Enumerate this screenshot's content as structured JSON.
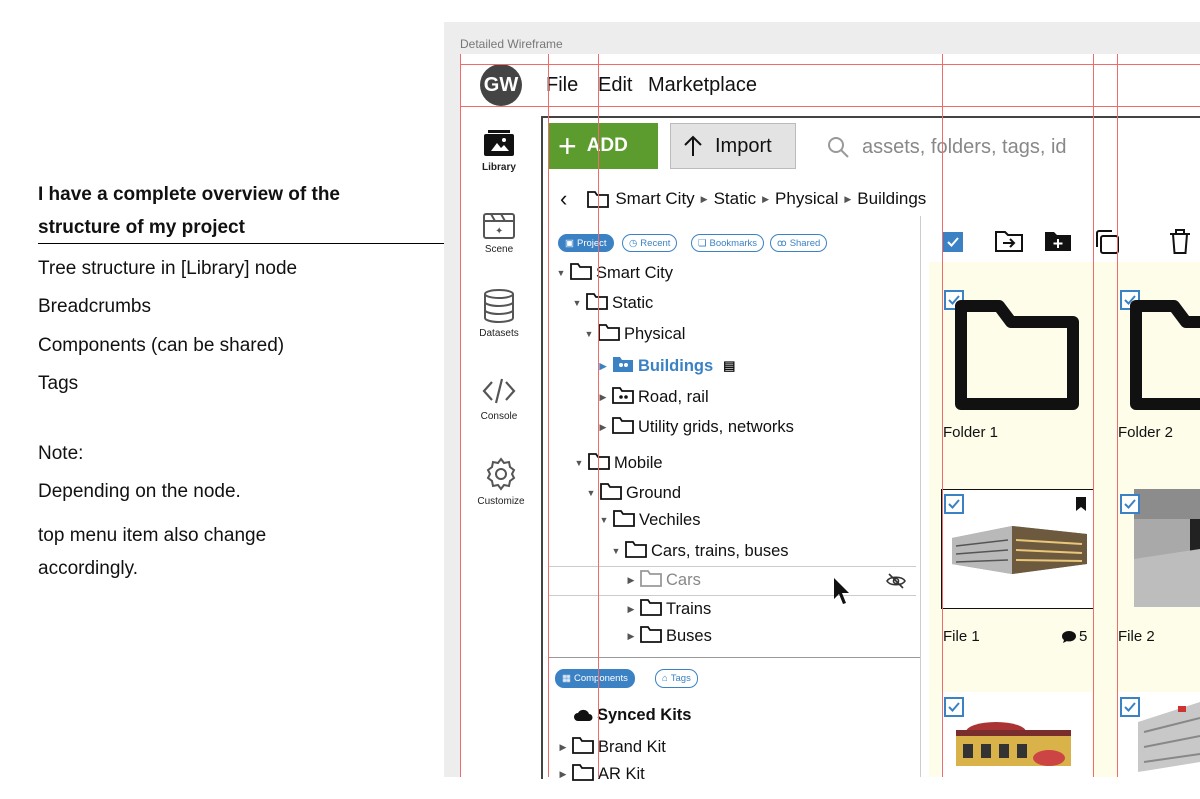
{
  "annotation": {
    "title": "I have a complete overview of the structure of my project",
    "points": [
      "Tree structure in [Library] node",
      "Breadcrumbs",
      "Components (can be shared)",
      "Tags"
    ],
    "note_label": "Note:",
    "note_lines": [
      "Depending on the node.",
      "top menu item also change accordingly."
    ]
  },
  "frame": {
    "label": "Detailed Wireframe"
  },
  "app": {
    "avatar": "GW",
    "menu": [
      "File",
      "Edit",
      "Marketplace"
    ]
  },
  "sidebar": {
    "items": [
      {
        "label": "Library",
        "icon": "library-icon"
      },
      {
        "label": "Scene",
        "icon": "scene-icon"
      },
      {
        "label": "Datasets",
        "icon": "database-icon"
      },
      {
        "label": "Console",
        "icon": "code-icon"
      },
      {
        "label": "Customize",
        "icon": "gear-icon"
      }
    ]
  },
  "toolbar": {
    "add_label": "ADD",
    "import_label": "Import",
    "search_placeholder": "assets, folders, tags, id"
  },
  "breadcrumb": [
    "Smart City",
    "Static",
    "Physical",
    "Buildings"
  ],
  "filters": [
    "Project",
    "Recent",
    "Bookmarks",
    "Shared"
  ],
  "tree": {
    "smart_city": "Smart City",
    "static": "Static",
    "physical": "Physical",
    "buildings": "Buildings",
    "road": "Road, rail",
    "utility": "Utility grids, networks",
    "mobile": "Mobile",
    "ground": "Ground",
    "vechiles": "Vechiles",
    "cars_trains": "Cars, trains, buses",
    "cars": "Cars",
    "trains": "Trains",
    "buses": "Buses"
  },
  "bottom_tabs": [
    "Components",
    "Tags"
  ],
  "kits": {
    "title": "Synced Kits",
    "items": [
      "Brand Kit",
      "AR Kit"
    ]
  },
  "assets": {
    "folder1": "Folder 1",
    "folder2": "Folder 2",
    "file1": "File 1",
    "file1_comments": "5",
    "file2": "File 2"
  },
  "colors": {
    "accent": "#3b82c4",
    "add": "#5c9c2e",
    "content_bg": "#fefde9",
    "grid": "#f06b6b"
  }
}
